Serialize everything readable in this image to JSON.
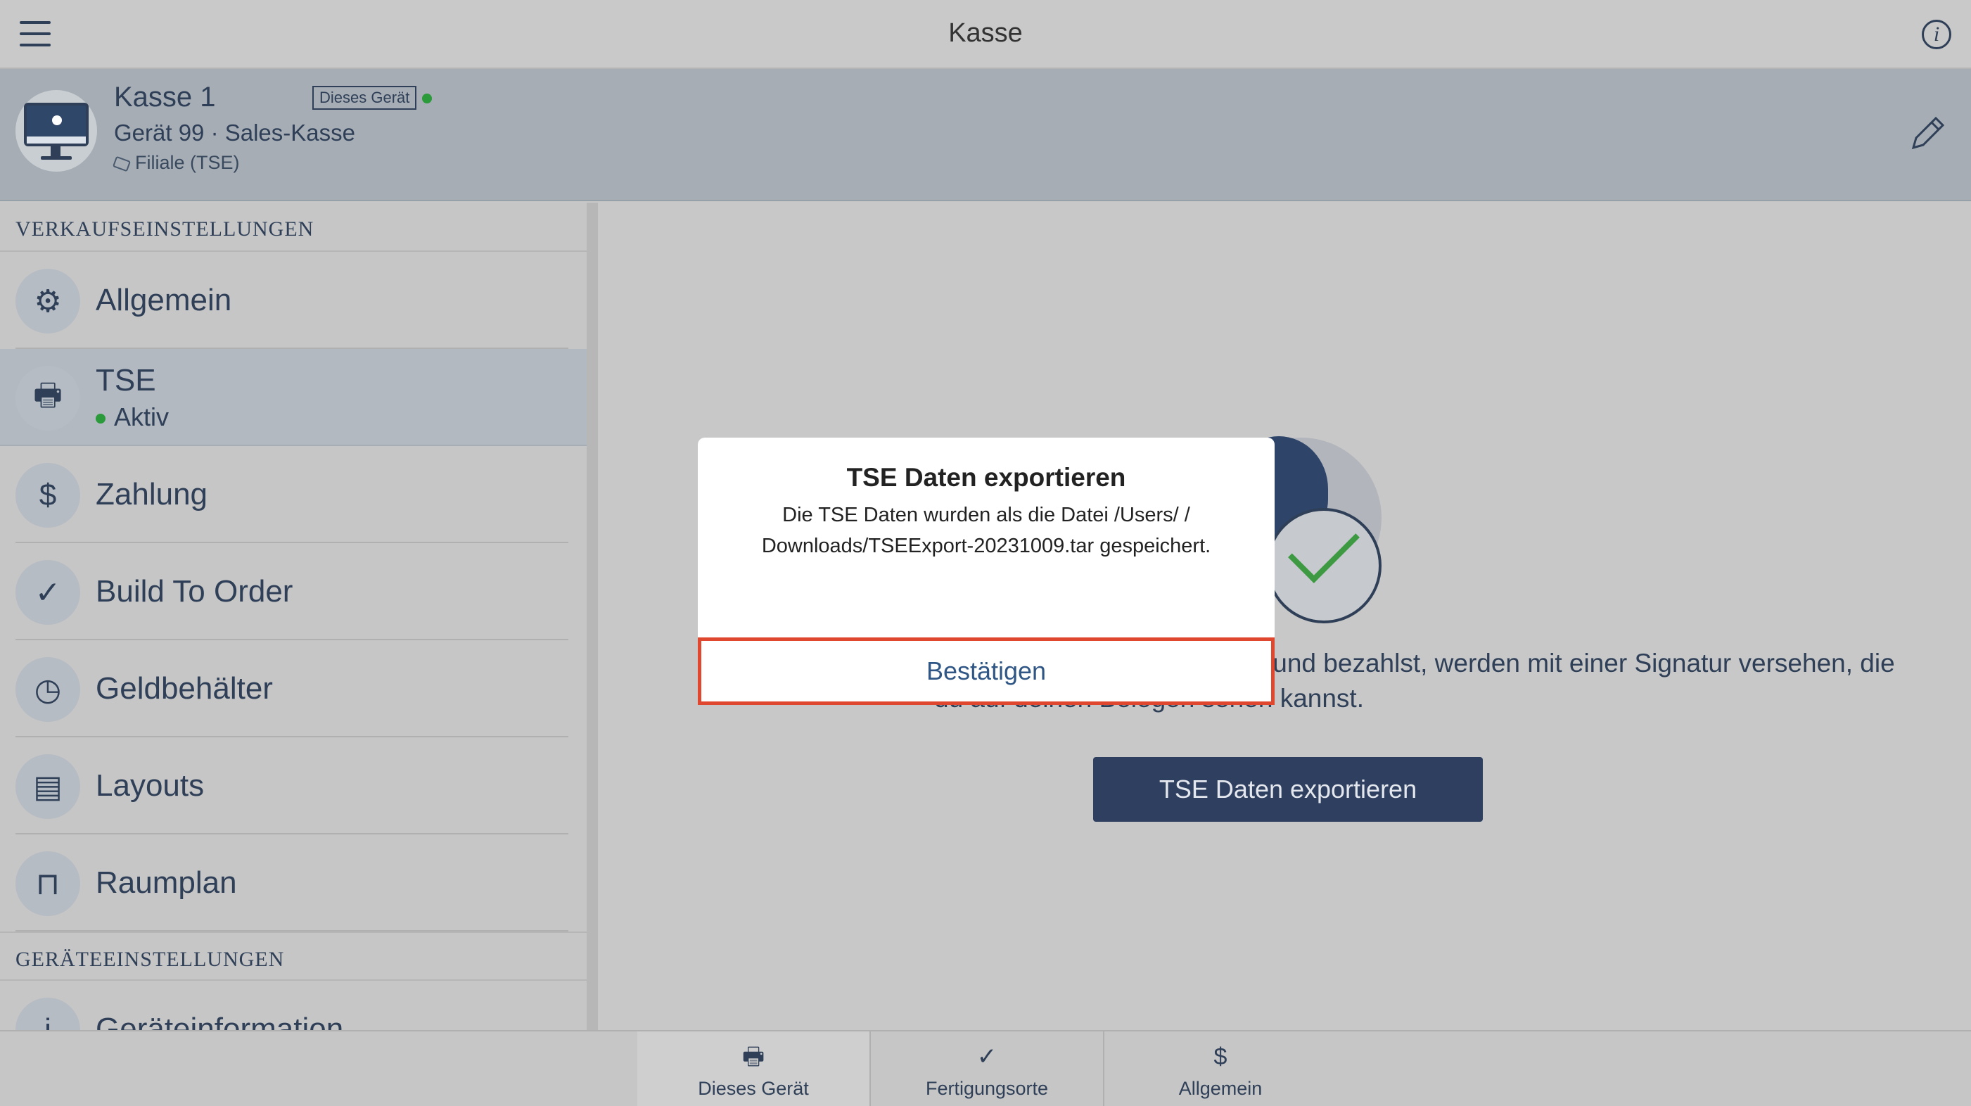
{
  "topbar": {
    "title": "Kasse",
    "menu_icon": "hamburger-icon",
    "info_icon": "info-icon"
  },
  "device": {
    "name": "Kasse 1",
    "badge": "Dieses Gerät",
    "status_color": "#2a9a3a",
    "subtitle": "Gerät 99 · Sales-Kasse",
    "branch": "Filiale (TSE)",
    "icon": "monitor-icon"
  },
  "sidebar": {
    "section_sales": "VERKAUFSEINSTELLUNGEN",
    "items": [
      {
        "label": "Allgemein",
        "icon": "gear-icon"
      },
      {
        "label": "TSE",
        "sub": "Aktiv",
        "icon": "tse-icon",
        "active": true
      },
      {
        "label": "Zahlung",
        "icon": "payment-icon"
      },
      {
        "label": "Build To Order",
        "icon": "build-to-order-icon"
      },
      {
        "label": "Geldbehälter",
        "icon": "cash-drawer-icon"
      },
      {
        "label": "Layouts",
        "icon": "register-icon"
      },
      {
        "label": "Raumplan",
        "icon": "table-icon"
      }
    ],
    "section_device": "GERÄTEEINSTELLUNGEN",
    "device_items": [
      {
        "label": "Geräteinformation",
        "icon": "info-icon"
      }
    ]
  },
  "main": {
    "description": "stellungen, die du aufnimmst und bezahlst, werden mit einer Signatur versehen, die du auf deinen Belegen sehen kannst.",
    "export_button": "TSE Daten exportieren"
  },
  "dialog": {
    "title": "TSE Daten exportieren",
    "message": "Die TSE Daten wurden als die Datei /Users/                   / Downloads/TSEExport-20231009.tar gespeichert.",
    "confirm": "Bestätigen",
    "highlight_color": "#e0472f"
  },
  "tabbar": {
    "tabs": [
      {
        "label": "Dieses Gerät",
        "icon": "register-icon",
        "active": true
      },
      {
        "label": "Fertigungsorte",
        "icon": "location-check-icon"
      },
      {
        "label": "Allgemein",
        "icon": "document-dollar-icon"
      }
    ]
  },
  "colors": {
    "accent": "#2e3f5f",
    "online": "#2a9a3a"
  }
}
